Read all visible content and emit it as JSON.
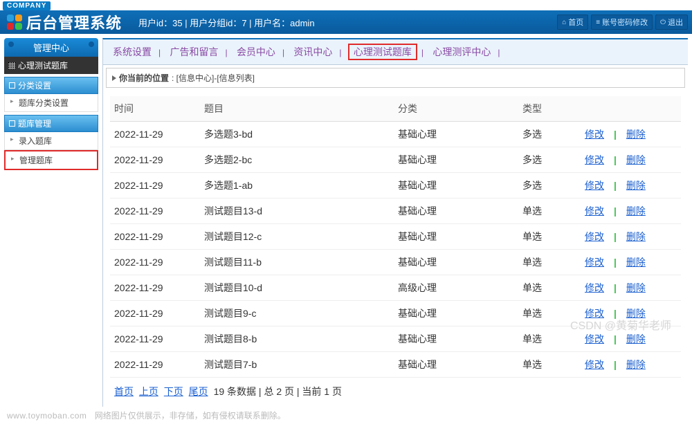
{
  "company_badge": "COMPANY",
  "system_title": "后台管理系统",
  "user_info": "用户id：35 | 用户分组id：7 | 用户名：admin",
  "header_buttons": {
    "home": "首页",
    "pwd": "账号密码修改",
    "logout": "退出"
  },
  "sidebar": {
    "header": "管理中心",
    "sub": "心理测试题库",
    "section1": "分类设置",
    "item1": "题库分类设置",
    "section2": "题库管理",
    "item2": "录入题库",
    "item3": "管理题库"
  },
  "tabs": {
    "t1": "系统设置",
    "t2": "广告和留言",
    "t3": "会员中心",
    "t4": "资讯中心",
    "t5": "心理测试题库",
    "t6": "心理测评中心"
  },
  "breadcrumb": {
    "label": "你当前的位置",
    "path": ": [信息中心]-[信息列表]"
  },
  "columns": {
    "time": "时间",
    "title": "题目",
    "cat": "分类",
    "type": "类型"
  },
  "rows": [
    {
      "time": "2022-11-29",
      "title": "多选题3-bd",
      "cat": "基础心理",
      "type": "多选"
    },
    {
      "time": "2022-11-29",
      "title": "多选题2-bc",
      "cat": "基础心理",
      "type": "多选"
    },
    {
      "time": "2022-11-29",
      "title": "多选题1-ab",
      "cat": "基础心理",
      "type": "多选"
    },
    {
      "time": "2022-11-29",
      "title": "测试题目13-d",
      "cat": "基础心理",
      "type": "单选"
    },
    {
      "time": "2022-11-29",
      "title": "测试题目12-c",
      "cat": "基础心理",
      "type": "单选"
    },
    {
      "time": "2022-11-29",
      "title": "测试题目11-b",
      "cat": "基础心理",
      "type": "单选"
    },
    {
      "time": "2022-11-29",
      "title": "测试题目10-d",
      "cat": "高级心理",
      "type": "单选"
    },
    {
      "time": "2022-11-29",
      "title": "测试题目9-c",
      "cat": "基础心理",
      "type": "单选"
    },
    {
      "time": "2022-11-29",
      "title": "测试题目8-b",
      "cat": "基础心理",
      "type": "单选"
    },
    {
      "time": "2022-11-29",
      "title": "测试题目7-b",
      "cat": "基础心理",
      "type": "单选"
    }
  ],
  "ops": {
    "edit": "修改",
    "del": "删除"
  },
  "pager": {
    "first": "首页",
    "prev": "上页",
    "next": "下页",
    "last": "尾页",
    "info": "19 条数据 | 总 2 页 | 当前 1 页"
  },
  "watermark": "CSDN @黄菊华老师",
  "footer": {
    "domain": "www.toymoban.com",
    "note": "网络图片仅供展示，非存储，如有侵权请联系删除。"
  }
}
